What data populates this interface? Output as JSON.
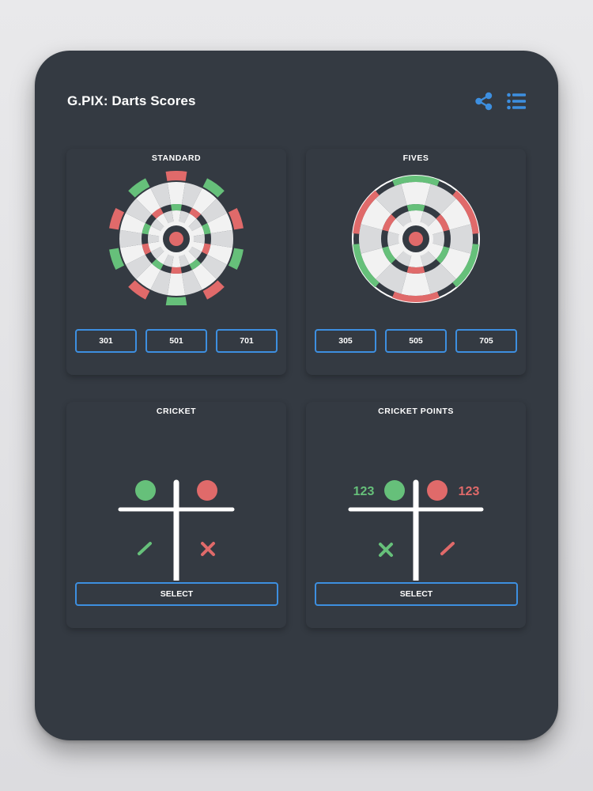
{
  "app": {
    "title": "G.PIX: Darts Scores",
    "accent_color": "#3d8fe0",
    "icons": [
      "share-icon",
      "list-menu-icon"
    ]
  },
  "colors": {
    "background": "#343a42",
    "green": "#66c07a",
    "red": "#e06a6a",
    "board_light": "#f2f2f2",
    "board_alt": "#d9dadc",
    "white": "#ffffff"
  },
  "cards": {
    "standard": {
      "title": "STANDARD",
      "buttons": [
        "301",
        "501",
        "701"
      ]
    },
    "fives": {
      "title": "FIVES",
      "buttons": [
        "305",
        "505",
        "705"
      ]
    },
    "cricket": {
      "title": "CRICKET",
      "select_label": "SELECT"
    },
    "cricket_points": {
      "title": "CRICKET POINTS",
      "left_score": "123",
      "right_score": "123",
      "select_label": "SELECT"
    }
  }
}
